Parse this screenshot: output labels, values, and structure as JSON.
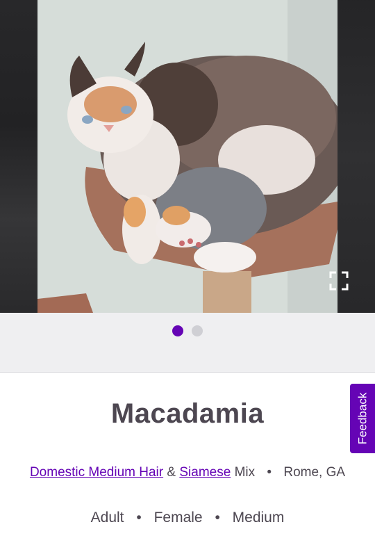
{
  "pet": {
    "name": "Macadamia",
    "breed_primary": "Domestic Medium Hair",
    "breed_joiner": "&",
    "breed_secondary": "Siamese",
    "breed_suffix": "Mix",
    "location": "Rome, GA",
    "age": "Adult",
    "sex": "Female",
    "size": "Medium"
  },
  "separator": "•",
  "carousel": {
    "photo_count": 2,
    "active_index": 1
  },
  "feedback": {
    "label": "Feedback"
  },
  "colors": {
    "accent": "#6504b5",
    "text": "#4d4751",
    "dot_inactive": "#cfcfd4",
    "dots_bg": "#efeff1"
  },
  "icons": {
    "expand": "expand-icon"
  }
}
